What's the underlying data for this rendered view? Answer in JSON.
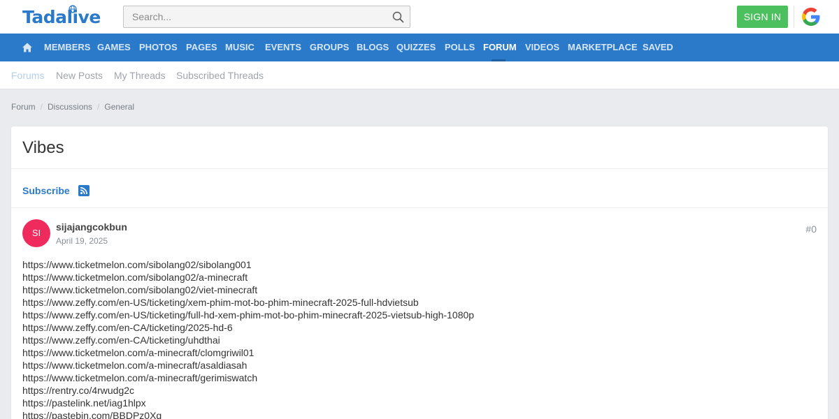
{
  "header": {
    "logo_text": "Tadalive",
    "search_placeholder": "Search...",
    "signin_label": "SIGN IN"
  },
  "nav": {
    "items": [
      "MEMBERS",
      "GAMES",
      "PHOTOS",
      "PAGES",
      "MUSIC",
      "EVENTS",
      "GROUPS",
      "BLOGS",
      "QUIZZES",
      "POLLS",
      "FORUM",
      "VIDEOS",
      "MARKETPLACE",
      "SAVED"
    ],
    "active": "FORUM"
  },
  "subnav": {
    "items": [
      "Forums",
      "New Posts",
      "My Threads",
      "Subscribed Threads"
    ]
  },
  "breadcrumb": [
    "Forum",
    "Discussions",
    "General"
  ],
  "thread": {
    "title": "Vibes",
    "subscribe_label": "Subscribe"
  },
  "post": {
    "avatar_initials": "SI",
    "author": "sijajangcokbun",
    "date": "April 19, 2025",
    "number": "#0",
    "lines": [
      "https://www.ticketmelon.com/sibolang02/sibolang001",
      "https://www.ticketmelon.com/sibolang02/a-minecraft",
      "https://www.ticketmelon.com/sibolang02/viet-minecraft",
      "https://www.zeffy.com/en-US/ticketing/xem-phim-mot-bo-phim-minecraft-2025-full-hdvietsub",
      "https://www.zeffy.com/en-US/ticketing/full-hd-xem-phim-mot-bo-phim-minecraft-2025-vietsub-high-1080p",
      "https://www.zeffy.com/en-CA/ticketing/2025-hd-6",
      "https://www.zeffy.com/en-CA/ticketing/uhdthai",
      "https://www.ticketmelon.com/a-minecraft/clomgriwil01",
      "https://www.ticketmelon.com/a-minecraft/asaldiasah",
      "https://www.ticketmelon.com/a-minecraft/gerimiswatch",
      "https://rentry.co/4rwudg2c",
      "https://pastelink.net/iag1hlpx",
      "https://pastebin.com/BBDPz0Xq"
    ]
  },
  "colors": {
    "brand_blue": "#2a7ac9",
    "signin_green": "#4cbf5f",
    "avatar_pink": "#ef2a5d"
  },
  "icons": [
    "globe-icon",
    "search-icon",
    "google-icon",
    "home-icon",
    "rss-icon"
  ]
}
